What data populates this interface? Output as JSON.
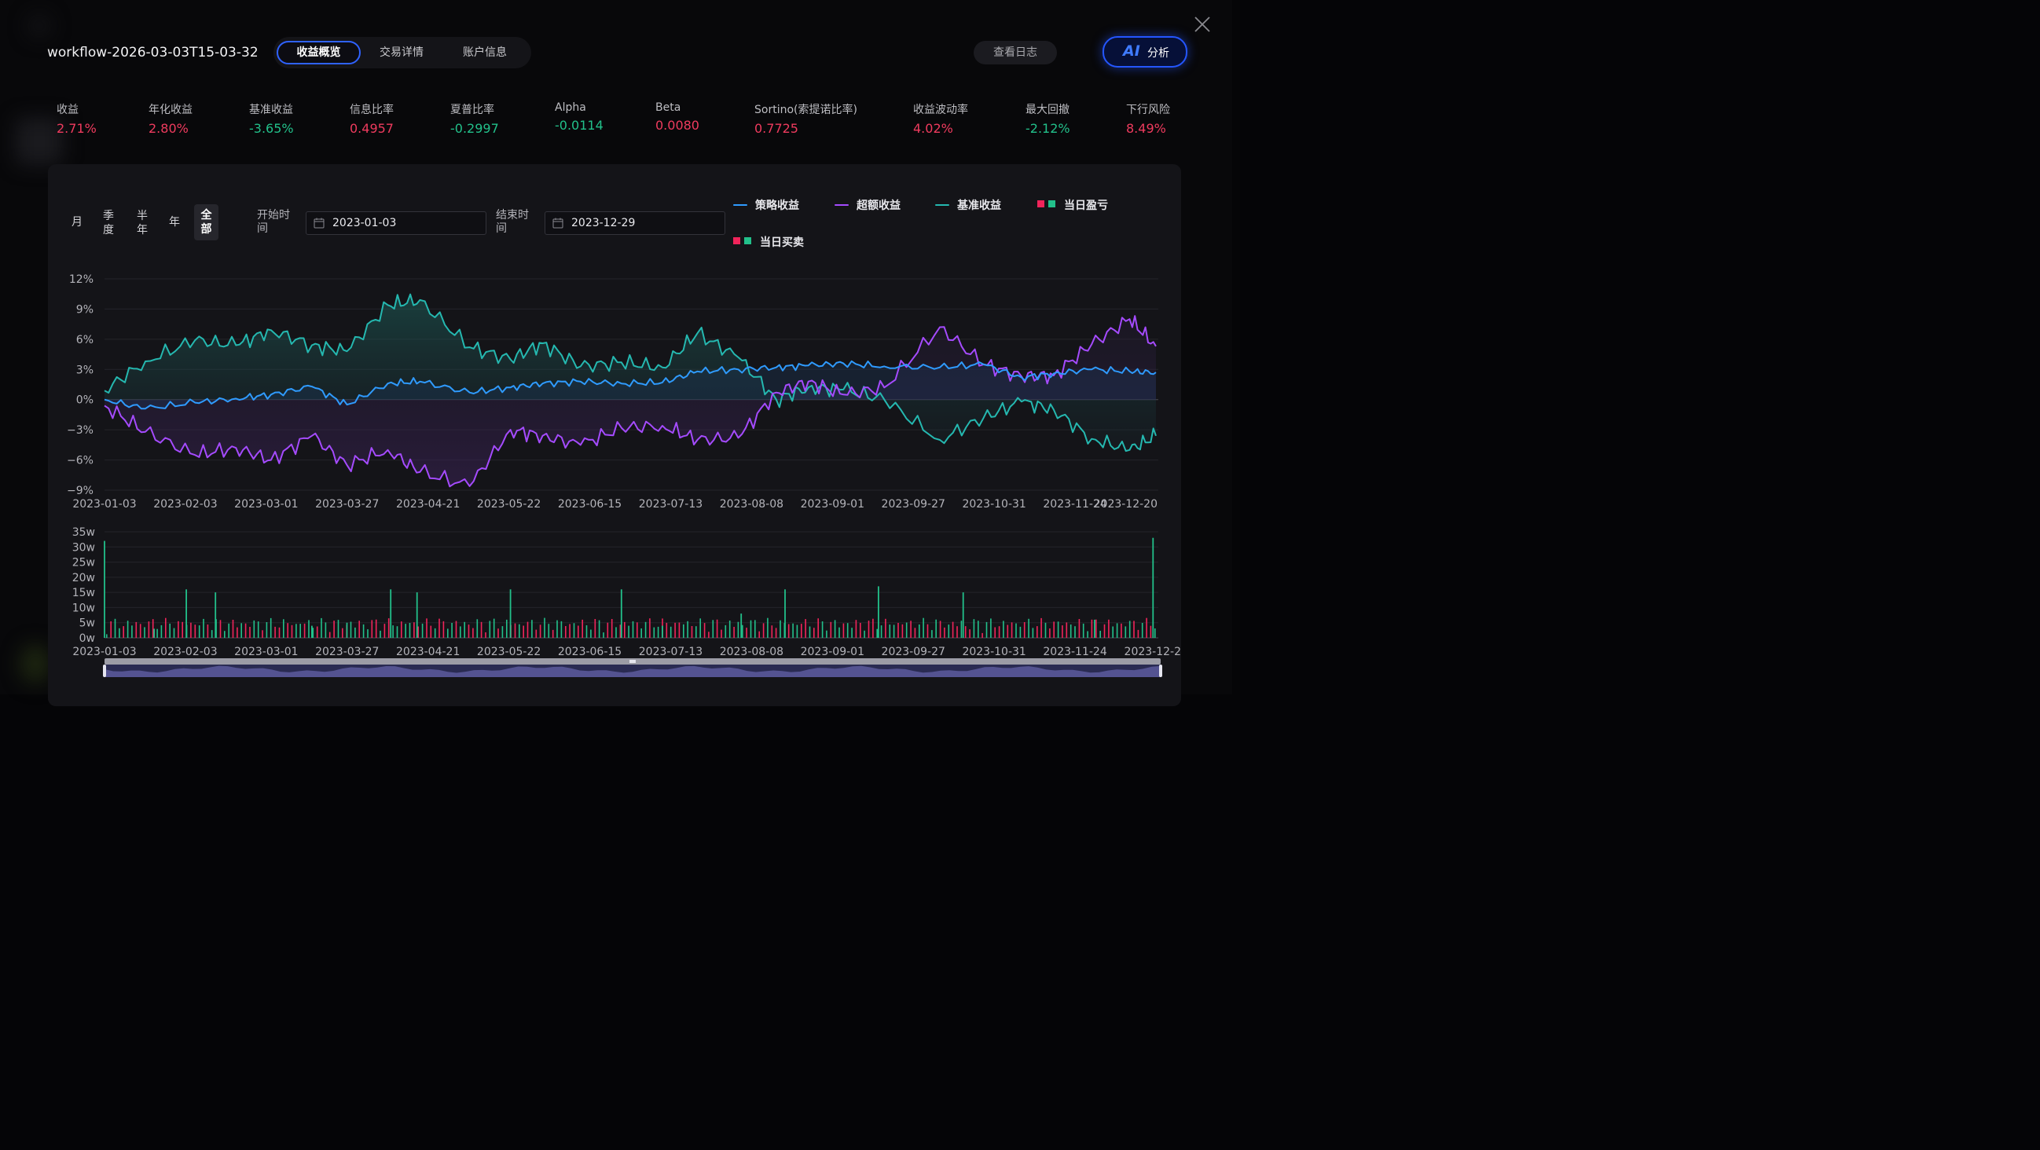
{
  "window": {
    "title": "workflow-2026-03-03T15-03-32"
  },
  "tabs": [
    {
      "label": "收益概览",
      "active": true
    },
    {
      "label": "交易详情",
      "active": false
    },
    {
      "label": "账户信息",
      "active": false
    }
  ],
  "header": {
    "log_button": "查看日志",
    "ai_mark": "AI",
    "ai_label": "分析"
  },
  "metrics": [
    {
      "label": "收益",
      "value": "2.71%",
      "sign": "pos"
    },
    {
      "label": "年化收益",
      "value": "2.80%",
      "sign": "pos"
    },
    {
      "label": "基准收益",
      "value": "-3.65%",
      "sign": "neg"
    },
    {
      "label": "信息比率",
      "value": "0.4957",
      "sign": "pos"
    },
    {
      "label": "夏普比率",
      "value": "-0.2997",
      "sign": "neg"
    },
    {
      "label": "Alpha",
      "value": "-0.0114",
      "sign": "neg"
    },
    {
      "label": "Beta",
      "value": "0.0080",
      "sign": "pos"
    },
    {
      "label": "Sortino(索提诺比率)",
      "value": "0.7725",
      "sign": "pos"
    },
    {
      "label": "收益波动率",
      "value": "4.02%",
      "sign": "pos"
    },
    {
      "label": "最大回撤",
      "value": "-2.12%",
      "sign": "neg"
    },
    {
      "label": "下行风险",
      "value": "8.49%",
      "sign": "pos"
    }
  ],
  "periods": [
    {
      "label": "月",
      "active": false
    },
    {
      "label": "季度",
      "active": false
    },
    {
      "label": "半年",
      "active": false
    },
    {
      "label": "年",
      "active": false
    },
    {
      "label": "全部",
      "active": true
    }
  ],
  "date_range": {
    "start_label": "开始时间",
    "start_value": "2023-01-03",
    "end_label": "结束时间",
    "end_value": "2023-12-29"
  },
  "legend": [
    {
      "label": "策略收益",
      "kind": "line",
      "color": "#2f9bff"
    },
    {
      "label": "超额收益",
      "kind": "line",
      "color": "#a54bff"
    },
    {
      "label": "基准收益",
      "kind": "line",
      "color": "#25b8b0"
    },
    {
      "label": "当日盈亏",
      "kind": "squares",
      "colors": [
        "#f0245a",
        "#22c08a"
      ]
    },
    {
      "label": "当日买卖",
      "kind": "squares",
      "colors": [
        "#f0245a",
        "#22c08a"
      ]
    }
  ],
  "colors": {
    "strategy": "#2f9bff",
    "excess": "#a54bff",
    "benchmark": "#25b8b0",
    "up": "#f0245a",
    "down": "#22c08a"
  },
  "chart_data": [
    {
      "type": "line",
      "x_range": [
        "2023-01-03",
        "2023-12-29"
      ],
      "x_tick_labels": [
        "2023-01-03",
        "2023-02-03",
        "2023-03-01",
        "2023-03-27",
        "2023-04-21",
        "2023-05-22",
        "2023-06-15",
        "2023-07-13",
        "2023-08-08",
        "2023-09-01",
        "2023-09-27",
        "2023-10-31",
        "2023-11-24",
        "2023-12-20"
      ],
      "y_tick_labels": [
        "12%",
        "9%",
        "6%",
        "3%",
        "0%",
        "−3%",
        "−6%",
        "−9%"
      ],
      "ylim": [
        -9,
        12
      ],
      "y_unit": "%",
      "x": [
        "2023-01-03",
        "2023-01-17",
        "2023-02-03",
        "2023-02-17",
        "2023-03-01",
        "2023-03-15",
        "2023-03-27",
        "2023-04-10",
        "2023-04-21",
        "2023-05-08",
        "2023-05-22",
        "2023-06-02",
        "2023-06-15",
        "2023-06-29",
        "2023-07-13",
        "2023-07-25",
        "2023-08-08",
        "2023-08-21",
        "2023-09-01",
        "2023-09-13",
        "2023-09-27",
        "2023-10-16",
        "2023-10-31",
        "2023-11-13",
        "2023-11-24",
        "2023-12-07",
        "2023-12-20",
        "2023-12-29"
      ],
      "series": [
        {
          "name": "策略收益",
          "values": [
            0.0,
            -0.9,
            -0.3,
            0.1,
            0.5,
            1.3,
            -0.5,
            1.6,
            1.8,
            0.7,
            1.2,
            1.6,
            1.8,
            1.6,
            1.7,
            2.8,
            3.0,
            3.2,
            3.4,
            3.6,
            3.3,
            3.2,
            3.5,
            2.2,
            2.6,
            3.0,
            2.8,
            2.7
          ]
        },
        {
          "name": "超额收益",
          "values": [
            -0.6,
            -3.2,
            -5.5,
            -4.8,
            -6.0,
            -3.6,
            -6.5,
            -5.0,
            -7.2,
            -8.6,
            -3.0,
            -3.6,
            -4.5,
            -2.8,
            -2.6,
            -4.0,
            -3.8,
            0.7,
            1.8,
            0.5,
            1.2,
            7.2,
            3.5,
            2.3,
            2.4,
            5.5,
            8.0,
            5.3
          ]
        },
        {
          "name": "基准收益",
          "values": [
            0.9,
            3.8,
            5.9,
            5.4,
            6.9,
            5.4,
            4.8,
            9.4,
            9.9,
            5.2,
            4.0,
            5.6,
            3.3,
            3.7,
            3.2,
            6.6,
            4.2,
            0.0,
            1.2,
            1.0,
            0.0,
            -4.0,
            -1.8,
            -0.2,
            -1.0,
            -3.9,
            -5.0,
            -3.6
          ]
        }
      ]
    },
    {
      "type": "bar",
      "x_range": [
        "2023-01-03",
        "2023-12-29"
      ],
      "x_tick_labels": [
        "2023-01-03",
        "2023-02-03",
        "2023-03-01",
        "2023-03-27",
        "2023-04-21",
        "2023-05-22",
        "2023-06-15",
        "2023-07-13",
        "2023-08-08",
        "2023-09-01",
        "2023-09-27",
        "2023-10-31",
        "2023-11-24",
        "2023-12-2"
      ],
      "y_tick_labels": [
        "35w",
        "30w",
        "25w",
        "20w",
        "15w",
        "10w",
        "5w",
        "0w"
      ],
      "ylim": [
        0,
        35
      ],
      "y_unit": "w",
      "x": [
        "2023-01-03",
        "2023-01-20",
        "2023-01-31",
        "2023-02-10",
        "2023-03-15",
        "2023-03-27",
        "2023-04-11",
        "2023-04-20",
        "2023-05-22",
        "2023-06-29",
        "2023-07-13",
        "2023-08-09",
        "2023-08-24",
        "2023-09-25",
        "2023-10-24",
        "2023-12-08",
        "2023-12-28"
      ],
      "series": [
        {
          "name": "",
          "values": [
            32,
            3,
            16,
            15,
            4,
            5,
            16,
            15,
            16,
            16,
            4,
            8,
            16,
            17,
            15,
            6,
            33
          ]
        }
      ]
    }
  ]
}
